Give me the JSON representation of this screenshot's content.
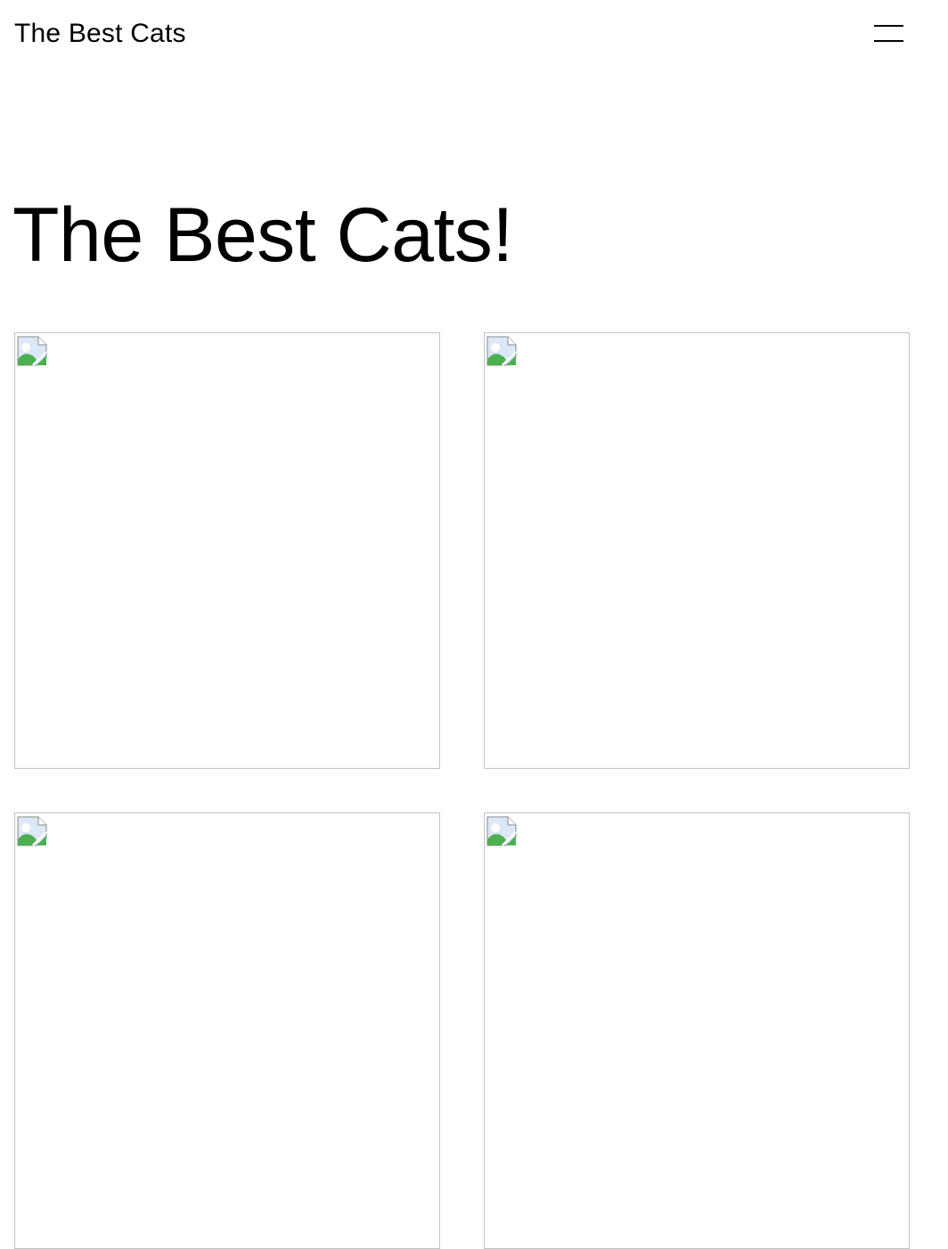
{
  "header": {
    "site_title": "The Best Cats",
    "menu_icon": "hamburger-menu-icon"
  },
  "main": {
    "title": "The Best Cats!",
    "gallery": [
      {
        "icon": "broken-image-icon"
      },
      {
        "icon": "broken-image-icon"
      },
      {
        "icon": "broken-image-icon"
      },
      {
        "icon": "broken-image-icon"
      }
    ]
  },
  "colors": {
    "text": "#000000",
    "background": "#ffffff",
    "image_border": "#c3c3c3"
  }
}
